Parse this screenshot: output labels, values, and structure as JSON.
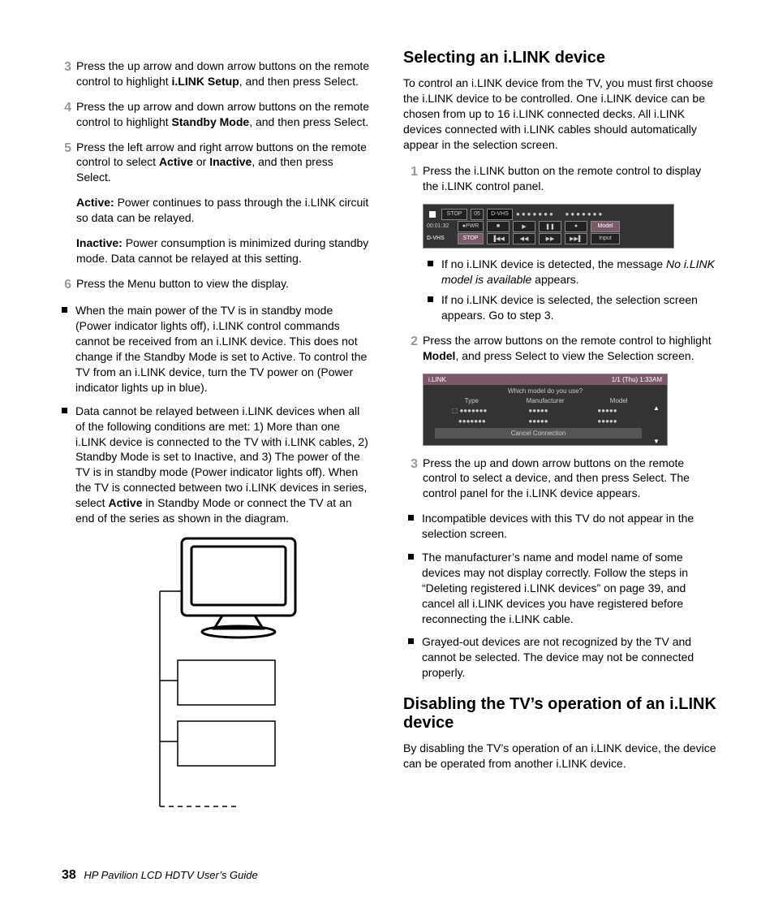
{
  "left": {
    "steps_a": [
      {
        "n": "3",
        "html": "Press the up arrow and down arrow buttons on the remote control to highlight <b>i.LINK Setup</b>, and then press Select."
      },
      {
        "n": "4",
        "html": "Press the up arrow and down arrow buttons on the remote control to highlight <b>Standby Mode</b>, and then press Select."
      },
      {
        "n": "5",
        "html": "Press the left arrow and right arrow buttons on the remote control to select <b>Active</b> or <b>Inactive</b>, and then press Select."
      }
    ],
    "active": "<b>Active:</b> Power continues to pass through the i.LINK circuit so data can be relayed.",
    "inactive": "<b>Inactive:</b> Power consumption is minimized during standby mode. Data cannot be relayed at this setting.",
    "step6": {
      "n": "6",
      "text": "Press the Menu button to view the display."
    },
    "bullets": [
      "When the main power of the TV is in standby mode (Power indicator lights off), i.LINK control commands cannot be received from an i.LINK device. This does not change if the Standby Mode is set to Active. To control the TV from an i.LINK device, turn the TV power on (Power indicator lights up in blue).",
      "Data cannot be relayed between i.LINK devices when all of the following conditions are met: 1) More than one i.LINK device is connected to the TV with i.LINK cables, 2) Standby Mode is set to Inactive, and 3) The power of the TV is in standby mode (Power indicator lights off). When the TV is connected between two i.LINK devices in series, select <b>Active</b> in Standby Mode or connect the TV at an end of the series as shown in the diagram."
    ]
  },
  "right": {
    "h1": "Selecting an i.LINK device",
    "intro1": "To control an i.LINK device from the TV, you must first choose the i.LINK device to be controlled. One i.LINK device can be chosen from up to 16 i.LINK connected decks. All i.LINK devices connected with i.LINK cables should automatically appear in the selection screen.",
    "step1": {
      "n": "1",
      "text": "Press the i.LINK button on the remote control to display the i.LINK control panel."
    },
    "panel1": {
      "stop": "STOP",
      "num": "05",
      "dvhs": "D-VHS",
      "time": "00:01:32",
      "pwr": "●PWR",
      "dvhs2": "D-VHS",
      "stop2": "STOP",
      "model": "Model",
      "input": "Input"
    },
    "sub1a": "If no i.LINK device is detected, the message <i>No i.LINK model is available</i> appears.",
    "sub1b": "If no i.LINK device is selected, the selection screen appears. Go to step 3.",
    "step2": {
      "n": "2",
      "html": "Press the arrow buttons on the remote control to highlight <b>Model</b>, and press Select to view the Selection screen."
    },
    "panel2": {
      "title": "i.LINK",
      "ts": "1/1 (Thu) 1:33AM",
      "q": "Which model do you use?",
      "c1": "Type",
      "c2": "Manufacturer",
      "c3": "Model",
      "cancel": "Cancel Connection"
    },
    "step3": {
      "n": "3",
      "text": "Press the up and down arrow buttons on the remote control to select a device, and then press Select. The control panel for the i.LINK device appears."
    },
    "bullets2": [
      "Incompatible devices with this TV do not appear in the selection screen.",
      "The manufacturer’s name and model name of some devices may not display correctly. Follow the steps in “Deleting registered i.LINK devices” on page 39, and cancel all i.LINK devices you have registered before reconnecting the i.LINK cable.",
      "Grayed-out devices are not recognized by the TV and cannot be selected. The device may not be connected properly."
    ],
    "h2": "Disabling the TV’s operation of an i.LINK device",
    "intro2": "By disabling the TV’s operation of an i.LINK device, the device can be operated from another i.LINK device."
  },
  "footer": {
    "page": "38",
    "title": "HP Pavilion LCD HDTV User’s Guide"
  }
}
